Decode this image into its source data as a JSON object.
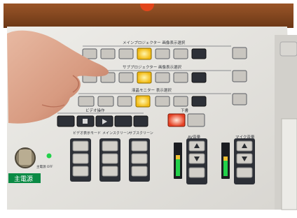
{
  "colors": {
    "wall_wood": "#8a4a22",
    "panel": "#e6e4df",
    "button_light": "#c9c6c0",
    "button_dark": "#2d3037",
    "lit_yellow": "#f6c21c",
    "lit_red": "#f24a2a",
    "power_label": "#0a8a44",
    "led_green": "#22d14a"
  },
  "labels": {
    "row1_header": "メインプロジェクター 画像表示選択",
    "row2_header": "サブプロジェクター 画像表示選択",
    "row3_header": "液晶モニター 表示選択",
    "video_header": "ビデオ操作",
    "presenter_label": "下書",
    "av_volume": "AV音量",
    "mic_volume": "マイク音量",
    "video_display_mode": "ビデオ表示モード",
    "main_screen": "メインスクリーン",
    "sub_screen": "サブスクリーン",
    "power_switch": "主電源",
    "power_small": "主電源 OFF"
  },
  "icons": {
    "finger": "pointing-hand",
    "play": "play-icon",
    "stop": "stop-icon",
    "up": "up-arrow-icon",
    "down": "down-arrow-icon"
  }
}
